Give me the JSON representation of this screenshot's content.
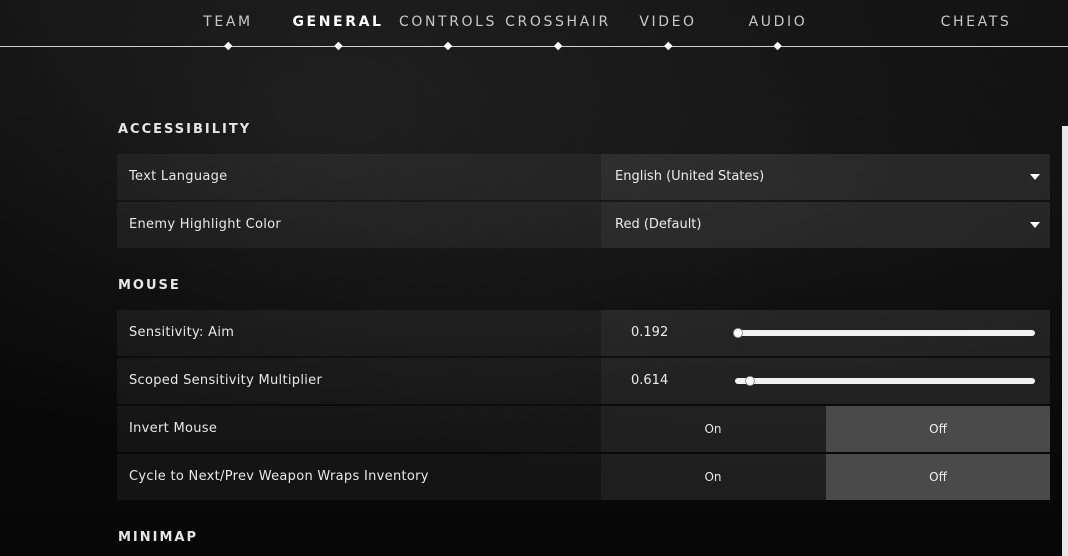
{
  "nav": {
    "tabs": [
      {
        "label": "TEAM",
        "active": false
      },
      {
        "label": "GENERAL",
        "active": true
      },
      {
        "label": "CONTROLS",
        "active": false
      },
      {
        "label": "CROSSHAIR",
        "active": false
      },
      {
        "label": "VIDEO",
        "active": false
      },
      {
        "label": "AUDIO",
        "active": false
      },
      {
        "label": "CHEATS",
        "active": false
      }
    ]
  },
  "accessibility": {
    "title": "ACCESSIBILITY",
    "text_language": {
      "label": "Text Language",
      "value": "English (United States)"
    },
    "enemy_highlight": {
      "label": "Enemy Highlight Color",
      "value": "Red (Default)"
    }
  },
  "mouse": {
    "title": "MOUSE",
    "sensitivity_aim": {
      "label": "Sensitivity: Aim",
      "value": "0.192",
      "fraction": 0.0
    },
    "scoped_multiplier": {
      "label": "Scoped Sensitivity Multiplier",
      "value": "0.614",
      "fraction": 0.04
    },
    "invert_mouse": {
      "label": "Invert Mouse",
      "on": "On",
      "off": "Off",
      "selected": "off"
    },
    "cycle_weapon": {
      "label": "Cycle to Next/Prev Weapon Wraps Inventory",
      "on": "On",
      "off": "Off",
      "selected": "off"
    }
  },
  "minimap": {
    "title": "MINIMAP"
  },
  "colors": {
    "accent": "#ffffff",
    "selected_toggle": "#4a4a4a"
  }
}
